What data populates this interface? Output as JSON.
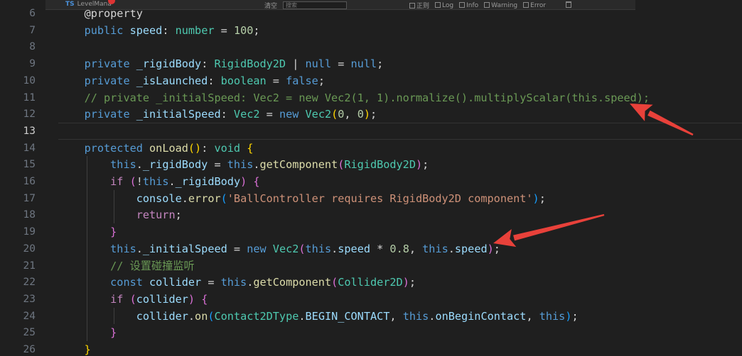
{
  "topbar": {
    "tab_lang": "TS",
    "tab_name": "LevelMana",
    "clear_label": "清空",
    "search_placeholder": "搜索",
    "filters": [
      "正则",
      "Log",
      "Info",
      "Warning",
      "Error"
    ]
  },
  "active_line": 13,
  "lines": [
    {
      "n": 6,
      "tokens": [
        [
          "    ",
          "p"
        ],
        [
          "@property",
          "p"
        ]
      ]
    },
    {
      "n": 7,
      "tokens": [
        [
          "    ",
          "p"
        ],
        [
          "public",
          "kw"
        ],
        [
          " ",
          "p"
        ],
        [
          "speed",
          "var"
        ],
        [
          ": ",
          "p"
        ],
        [
          "number",
          "ty"
        ],
        [
          " = ",
          "p"
        ],
        [
          "100",
          "num"
        ],
        [
          ";",
          "p"
        ]
      ]
    },
    {
      "n": 8,
      "tokens": []
    },
    {
      "n": 9,
      "tokens": [
        [
          "    ",
          "p"
        ],
        [
          "private",
          "kw"
        ],
        [
          " ",
          "p"
        ],
        [
          "_rigidBody",
          "var"
        ],
        [
          ": ",
          "p"
        ],
        [
          "RigidBody2D",
          "ty"
        ],
        [
          " | ",
          "p"
        ],
        [
          "null",
          "kw"
        ],
        [
          " = ",
          "p"
        ],
        [
          "null",
          "kw"
        ],
        [
          ";",
          "p"
        ]
      ]
    },
    {
      "n": 10,
      "tokens": [
        [
          "    ",
          "p"
        ],
        [
          "private",
          "kw"
        ],
        [
          " ",
          "p"
        ],
        [
          "_isLaunched",
          "var"
        ],
        [
          ": ",
          "p"
        ],
        [
          "boolean",
          "ty"
        ],
        [
          " = ",
          "p"
        ],
        [
          "false",
          "kw"
        ],
        [
          ";",
          "p"
        ]
      ]
    },
    {
      "n": 11,
      "tokens": [
        [
          "    ",
          "p"
        ],
        [
          "// private _initialSpeed: Vec2 = new Vec2(1, 1).normalize().multiplyScalar(this.speed);",
          "cm"
        ]
      ]
    },
    {
      "n": 12,
      "tokens": [
        [
          "    ",
          "p"
        ],
        [
          "private",
          "kw"
        ],
        [
          " ",
          "p"
        ],
        [
          "_initialSpeed",
          "var"
        ],
        [
          ": ",
          "p"
        ],
        [
          "Vec2",
          "ty"
        ],
        [
          " = ",
          "p"
        ],
        [
          "new",
          "kw"
        ],
        [
          " ",
          "p"
        ],
        [
          "Vec2",
          "ty"
        ],
        [
          "(",
          "br1"
        ],
        [
          "0",
          "num"
        ],
        [
          ", ",
          "p"
        ],
        [
          "0",
          "num"
        ],
        [
          ")",
          "br1"
        ],
        [
          ";",
          "p"
        ]
      ]
    },
    {
      "n": 13,
      "tokens": []
    },
    {
      "n": 14,
      "tokens": [
        [
          "    ",
          "p"
        ],
        [
          "protected",
          "kw"
        ],
        [
          " ",
          "p"
        ],
        [
          "onLoad",
          "fn"
        ],
        [
          "()",
          "br1"
        ],
        [
          ": ",
          "p"
        ],
        [
          "void",
          "ty"
        ],
        [
          " ",
          "p"
        ],
        [
          "{",
          "br1"
        ]
      ]
    },
    {
      "n": 15,
      "tokens": [
        [
          "        ",
          "p"
        ],
        [
          "this",
          "kw"
        ],
        [
          ".",
          "p"
        ],
        [
          "_rigidBody",
          "var"
        ],
        [
          " = ",
          "p"
        ],
        [
          "this",
          "kw"
        ],
        [
          ".",
          "p"
        ],
        [
          "getComponent",
          "fn"
        ],
        [
          "(",
          "br2"
        ],
        [
          "RigidBody2D",
          "ty"
        ],
        [
          ")",
          "br2"
        ],
        [
          ";",
          "p"
        ]
      ]
    },
    {
      "n": 16,
      "tokens": [
        [
          "        ",
          "p"
        ],
        [
          "if",
          "ctl"
        ],
        [
          " ",
          "p"
        ],
        [
          "(",
          "br2"
        ],
        [
          "!",
          "p"
        ],
        [
          "this",
          "kw"
        ],
        [
          ".",
          "p"
        ],
        [
          "_rigidBody",
          "var"
        ],
        [
          ")",
          "br2"
        ],
        [
          " ",
          "p"
        ],
        [
          "{",
          "br2"
        ]
      ]
    },
    {
      "n": 17,
      "tokens": [
        [
          "            ",
          "p"
        ],
        [
          "console",
          "var"
        ],
        [
          ".",
          "p"
        ],
        [
          "error",
          "fn"
        ],
        [
          "(",
          "br3"
        ],
        [
          "'BallController requires RigidBody2D component'",
          "str"
        ],
        [
          ")",
          "br3"
        ],
        [
          ";",
          "p"
        ]
      ]
    },
    {
      "n": 18,
      "tokens": [
        [
          "            ",
          "p"
        ],
        [
          "return",
          "ctl"
        ],
        [
          ";",
          "p"
        ]
      ]
    },
    {
      "n": 19,
      "tokens": [
        [
          "        ",
          "p"
        ],
        [
          "}",
          "br2"
        ]
      ]
    },
    {
      "n": 20,
      "tokens": [
        [
          "        ",
          "p"
        ],
        [
          "this",
          "kw"
        ],
        [
          ".",
          "p"
        ],
        [
          "_initialSpeed",
          "var"
        ],
        [
          " = ",
          "p"
        ],
        [
          "new",
          "kw"
        ],
        [
          " ",
          "p"
        ],
        [
          "Vec2",
          "ty"
        ],
        [
          "(",
          "br2"
        ],
        [
          "this",
          "kw"
        ],
        [
          ".",
          "p"
        ],
        [
          "speed",
          "var"
        ],
        [
          " * ",
          "p"
        ],
        [
          "0.8",
          "num"
        ],
        [
          ", ",
          "p"
        ],
        [
          "this",
          "kw"
        ],
        [
          ".",
          "p"
        ],
        [
          "speed",
          "var"
        ],
        [
          ")",
          "br2"
        ],
        [
          ";",
          "p"
        ]
      ]
    },
    {
      "n": 21,
      "tokens": [
        [
          "        ",
          "p"
        ],
        [
          "// 设置碰撞监听",
          "cm"
        ]
      ]
    },
    {
      "n": 22,
      "tokens": [
        [
          "        ",
          "p"
        ],
        [
          "const",
          "kw"
        ],
        [
          " ",
          "p"
        ],
        [
          "collider",
          "var"
        ],
        [
          " = ",
          "p"
        ],
        [
          "this",
          "kw"
        ],
        [
          ".",
          "p"
        ],
        [
          "getComponent",
          "fn"
        ],
        [
          "(",
          "br2"
        ],
        [
          "Collider2D",
          "ty"
        ],
        [
          ")",
          "br2"
        ],
        [
          ";",
          "p"
        ]
      ]
    },
    {
      "n": 23,
      "tokens": [
        [
          "        ",
          "p"
        ],
        [
          "if",
          "ctl"
        ],
        [
          " ",
          "p"
        ],
        [
          "(",
          "br2"
        ],
        [
          "collider",
          "var"
        ],
        [
          ")",
          "br2"
        ],
        [
          " ",
          "p"
        ],
        [
          "{",
          "br2"
        ]
      ]
    },
    {
      "n": 24,
      "tokens": [
        [
          "            ",
          "p"
        ],
        [
          "collider",
          "var"
        ],
        [
          ".",
          "p"
        ],
        [
          "on",
          "fn"
        ],
        [
          "(",
          "br3"
        ],
        [
          "Contact2DType",
          "ty"
        ],
        [
          ".",
          "p"
        ],
        [
          "BEGIN_CONTACT",
          "var"
        ],
        [
          ", ",
          "p"
        ],
        [
          "this",
          "kw"
        ],
        [
          ".",
          "p"
        ],
        [
          "onBeginContact",
          "var"
        ],
        [
          ", ",
          "p"
        ],
        [
          "this",
          "kw"
        ],
        [
          ")",
          "br3"
        ],
        [
          ";",
          "p"
        ]
      ]
    },
    {
      "n": 25,
      "tokens": [
        [
          "        ",
          "p"
        ],
        [
          "}",
          "br2"
        ]
      ]
    },
    {
      "n": 26,
      "tokens": [
        [
          "    ",
          "p"
        ],
        [
          "}",
          "br1"
        ]
      ]
    }
  ],
  "annotations": {
    "arrow_color": "#e8413a",
    "arrows": [
      "arrow pointing at this.speed in commented line 11",
      "arrow pointing at this.speed in line 20"
    ]
  }
}
